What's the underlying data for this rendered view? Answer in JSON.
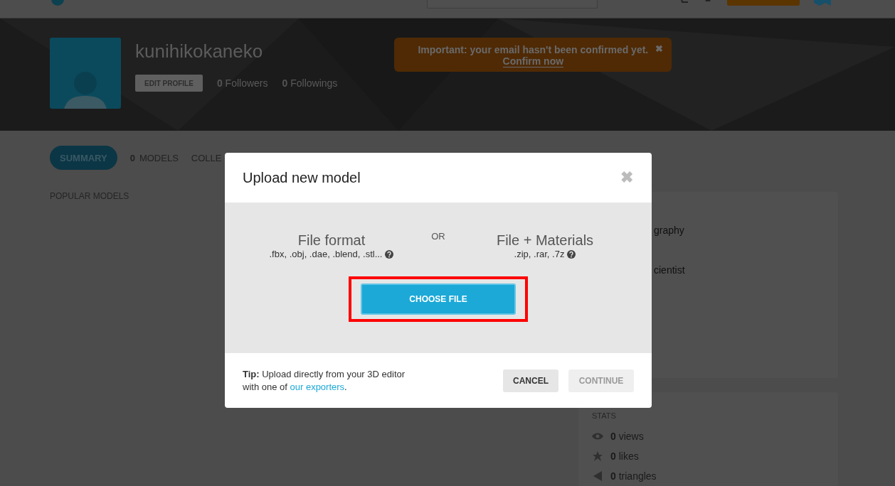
{
  "header": {
    "username": "kunihikokaneko",
    "edit_button": "EDIT PROFILE",
    "counts": [
      {
        "count": "0",
        "label": "Followers"
      },
      {
        "count": "0",
        "label": "Followings"
      }
    ],
    "alert": {
      "text": "Important: your email hasn't been confirmed yet.",
      "link": "Confirm now",
      "close": "✖"
    }
  },
  "tabs": [
    {
      "label": "SUMMARY",
      "selected": true
    },
    {
      "count": "0",
      "label": "MODELS",
      "selected": false
    },
    {
      "label": "COLLE",
      "selected": false
    }
  ],
  "section_title": "POPULAR MODELS",
  "info_card": {
    "fragments": [
      "graphy",
      "cientist"
    ]
  },
  "stats": {
    "title": "STATS",
    "items": [
      {
        "kind": "views",
        "count": "0",
        "label": "views"
      },
      {
        "kind": "likes",
        "count": "0",
        "label": "likes"
      },
      {
        "kind": "triangles",
        "count": "0",
        "label": "triangles"
      }
    ]
  },
  "modal": {
    "title": "Upload new model",
    "close": "✖",
    "or": "OR",
    "options": [
      {
        "title": "File format",
        "formats": ".fbx, .obj, .dae, .blend, .stl..."
      },
      {
        "title": "File + Materials",
        "formats": ".zip, .rar, .7z"
      }
    ],
    "choose_button": "CHOOSE FILE",
    "highlighted": true,
    "tip": "**Tip:** Upload directly from your 3D editor with one of",
    "tip_link": "our exporters",
    "tip_end": ".",
    "buttons": [
      {
        "label": "CANCEL",
        "disabled": false
      },
      {
        "label": "CONTINUE",
        "disabled": true
      }
    ]
  }
}
